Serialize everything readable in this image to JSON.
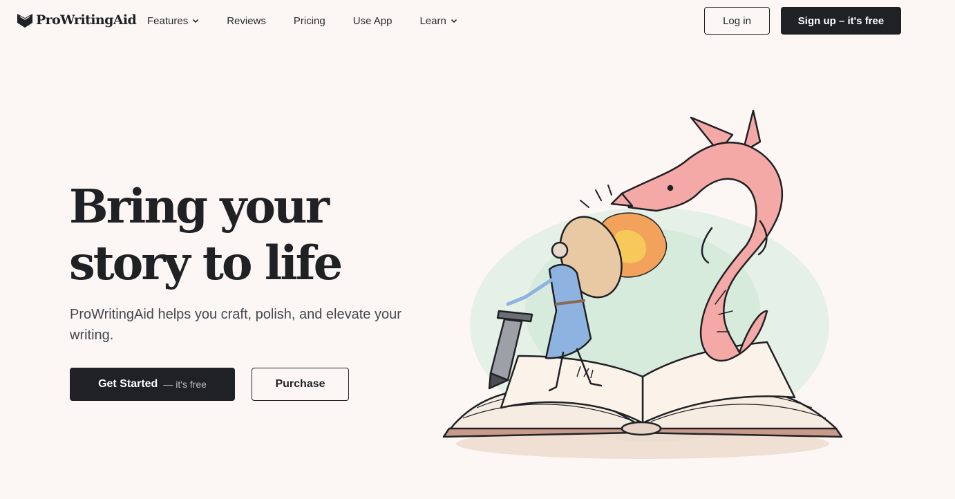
{
  "brand": {
    "name": "ProWritingAid"
  },
  "nav": {
    "items": [
      {
        "label": "Features",
        "dropdown": true
      },
      {
        "label": "Reviews",
        "dropdown": false
      },
      {
        "label": "Pricing",
        "dropdown": false
      },
      {
        "label": "Use App",
        "dropdown": false
      },
      {
        "label": "Learn",
        "dropdown": true
      }
    ],
    "login_label": "Log in",
    "signup_label": "Sign up – it's free"
  },
  "hero": {
    "title_line1": "Bring your",
    "title_line2": "story to life",
    "subtitle": "ProWritingAid helps you craft, polish, and elevate your writing.",
    "get_started_label": "Get Started",
    "get_started_suffix": "— it's free",
    "purchase_label": "Purchase"
  },
  "colors": {
    "background": "#fcf7f5",
    "primary_dark": "#1f2124",
    "dragon_pink": "#f4a9a6",
    "tunic_blue": "#8fb3e0",
    "fire_orange": "#f2a25a"
  },
  "icons": {
    "logo": "book-heart-logo-icon",
    "dropdown": "chevron-down-icon"
  }
}
